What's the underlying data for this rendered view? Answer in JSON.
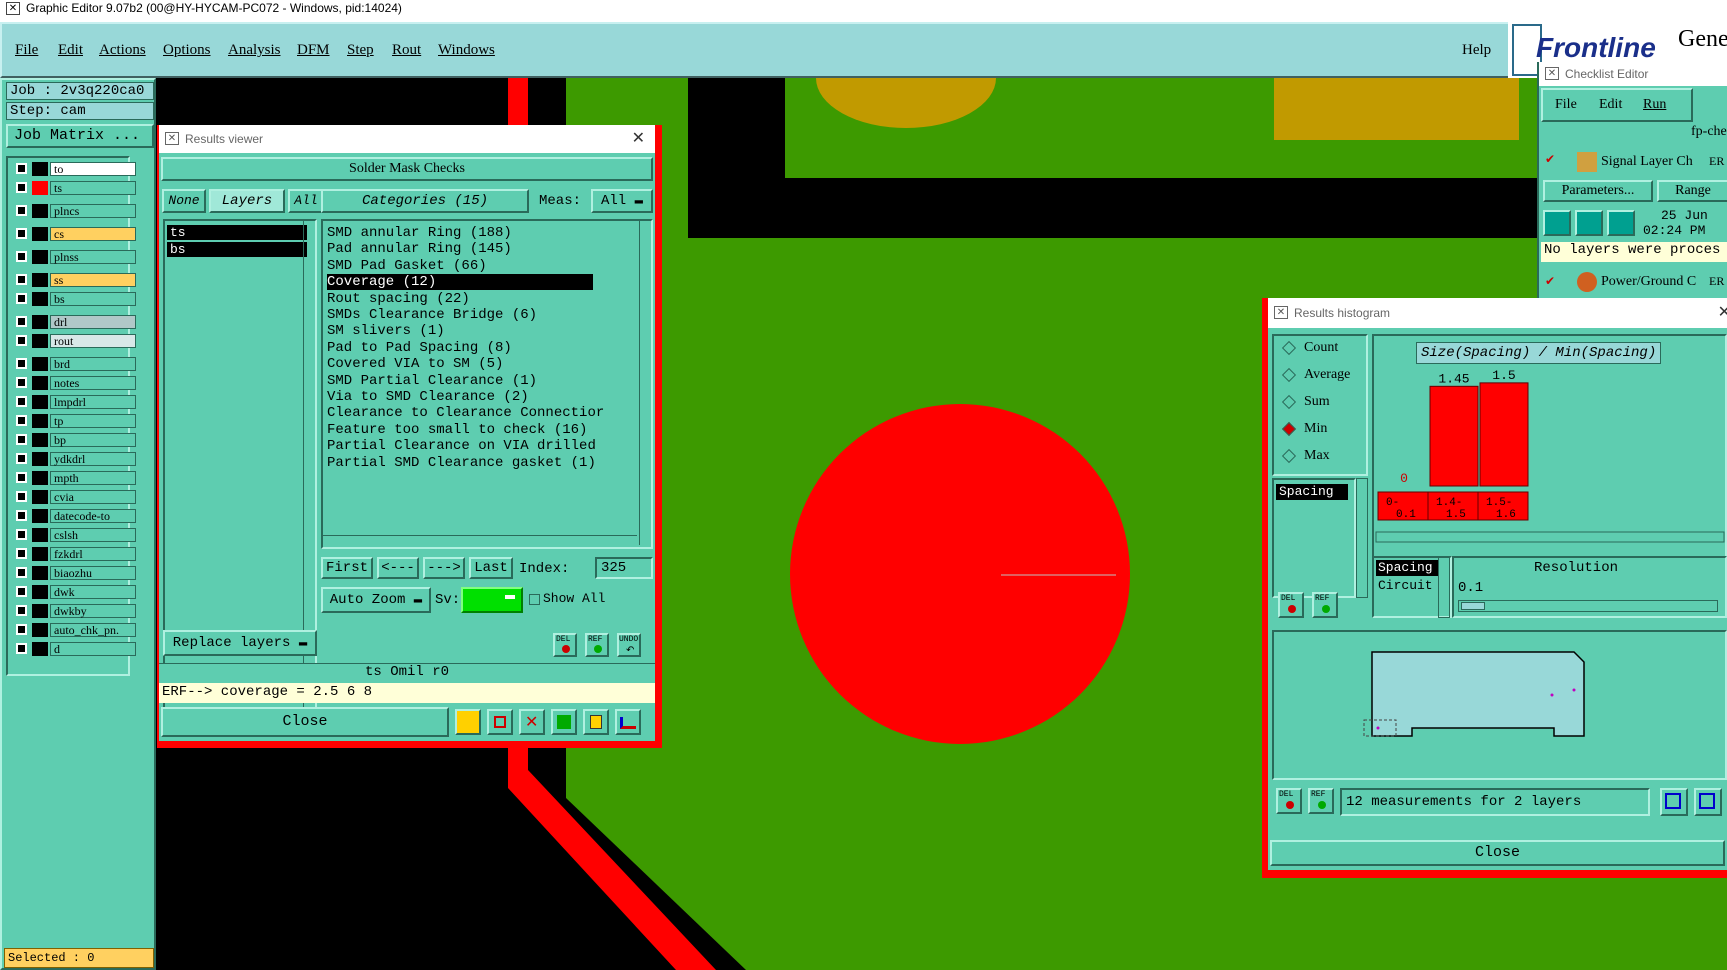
{
  "window": {
    "title": "Graphic Editor 9.07b2 (00@HY-HYCAM-PC072 - Windows, pid:14024)"
  },
  "menu": {
    "items": [
      "File",
      "Edit",
      "Actions",
      "Options",
      "Analysis",
      "DFM",
      "Step",
      "Rout",
      "Windows"
    ],
    "help": "Help",
    "brand": "Frontline",
    "brand2": "Gene"
  },
  "job": {
    "job": "Job : 2v3q220ca0",
    "step": "Step: cam",
    "matrix_btn": "Job Matrix ...",
    "selected": "Selected : 0"
  },
  "layers": [
    {
      "name": "to",
      "color": "#ffffff",
      "swatch": "#000000"
    },
    {
      "name": "ts",
      "color": "#5ecdb0",
      "swatch": "#ff0000",
      "active": true
    },
    {
      "name": "plncs",
      "color": "#5ecdb0",
      "swatch": "#000000"
    },
    {
      "name": "cs",
      "color": "#ffd060",
      "swatch": "#000000"
    },
    {
      "name": "plnss",
      "color": "#5ecdb0",
      "swatch": "#000000"
    },
    {
      "name": "ss",
      "color": "#ffd060",
      "swatch": "#000000"
    },
    {
      "name": "bs",
      "color": "#5ecdb0",
      "swatch": "#000000"
    },
    {
      "name": "drl",
      "color": "#b0c8c8",
      "swatch": "#000000"
    },
    {
      "name": "rout",
      "color": "#d8e8e8",
      "swatch": "#000000"
    },
    {
      "name": "brd",
      "color": "#5ecdb0",
      "swatch": "#000000"
    },
    {
      "name": "notes",
      "color": "#5ecdb0",
      "swatch": "#000000"
    },
    {
      "name": "lmpdrl",
      "color": "#5ecdb0",
      "swatch": "#000000"
    },
    {
      "name": "tp",
      "color": "#5ecdb0",
      "swatch": "#000000"
    },
    {
      "name": "bp",
      "color": "#5ecdb0",
      "swatch": "#000000"
    },
    {
      "name": "ydkdrl",
      "color": "#5ecdb0",
      "swatch": "#000000"
    },
    {
      "name": "mpth",
      "color": "#5ecdb0",
      "swatch": "#000000"
    },
    {
      "name": "cvia",
      "color": "#5ecdb0",
      "swatch": "#000000"
    },
    {
      "name": "datecode-to",
      "color": "#5ecdb0",
      "swatch": "#000000"
    },
    {
      "name": "cslsh",
      "color": "#5ecdb0",
      "swatch": "#000000"
    },
    {
      "name": "fzkdrl",
      "color": "#5ecdb0",
      "swatch": "#000000"
    },
    {
      "name": "biaozhu",
      "color": "#5ecdb0",
      "swatch": "#000000"
    },
    {
      "name": "dwk",
      "color": "#5ecdb0",
      "swatch": "#000000"
    },
    {
      "name": "dwkby",
      "color": "#5ecdb0",
      "swatch": "#000000"
    },
    {
      "name": "auto_chk_pn.",
      "color": "#5ecdb0",
      "swatch": "#000000"
    },
    {
      "name": "d",
      "color": "#5ecdb0",
      "swatch": "#000000"
    }
  ],
  "results_viewer": {
    "title": "Results viewer",
    "header": "Solder Mask Checks",
    "none": "None",
    "layers_label": "Layers",
    "all": "All",
    "categories_label": "Categories (15)",
    "meas_label": "Meas:",
    "meas_value": "All",
    "layer_list": [
      "ts",
      "bs"
    ],
    "categories": [
      "SMD annular Ring (188)",
      "Pad annular Ring (145)",
      "SMD Pad Gasket (66)",
      "Coverage (12)",
      "Rout spacing (22)",
      "SMDs Clearance Bridge (6)",
      "SM slivers (1)",
      "Pad to Pad Spacing (8)",
      "Covered VIA to SM (5)",
      "SMD Partial Clearance (1)",
      "Via to SMD Clearance (2)",
      "Clearance to Clearance Connectior",
      "Feature too small to check (16)",
      "Partial Clearance on VIA drilled",
      "Partial SMD Clearance gasket (1)"
    ],
    "selected_category": 3,
    "nav": {
      "first": "First",
      "prev": "<---",
      "next": "--->",
      "last": "Last",
      "index_label": "Index:",
      "index_value": "325"
    },
    "auto_zoom": "Auto Zoom",
    "sv_label": "Sv:",
    "show_all": "Show All",
    "replace_layers": "Replace layers",
    "small_btns": [
      "DEL",
      "REF",
      "UNDO"
    ],
    "status1": "ts Omil  r0",
    "status2": "ERF--> coverage = 2.5 6 8",
    "close": "Close"
  },
  "checklist": {
    "title": "Checklist Editor",
    "menu": [
      "File",
      "Edit",
      "Run"
    ],
    "name": "fp-che",
    "item1": "Signal Layer Ch",
    "item1_tag": "ER",
    "params": "Parameters...",
    "range": "Range",
    "date": "25 Jun",
    "time": "02:24 PM",
    "msg": "No layers were proces",
    "item2": "Power/Ground C",
    "item2_tag": "ER"
  },
  "histogram": {
    "title": "Results histogram",
    "modes": [
      "Count",
      "Average",
      "Sum",
      "Min",
      "Max"
    ],
    "selected_mode": "Min",
    "measure_list": [
      "Spacing"
    ],
    "chart_title": "Size(Spacing) / Min(Spacing)",
    "chart_data": {
      "type": "bar",
      "categories": [
        "0-0.1",
        "1.4-1.5",
        "1.5-1.6"
      ],
      "values": [
        0,
        1.45,
        1.5
      ],
      "value_labels": [
        "0",
        "1.45",
        "1.5"
      ],
      "title": "Size(Spacing) / Min(Spacing)",
      "ylim": [
        0,
        1.6
      ]
    },
    "types": [
      "Spacing",
      "Circuit"
    ],
    "resolution_label": "Resolution",
    "resolution_value": "0.1",
    "measurements": "12 measurements for 2 layers",
    "close": "Close",
    "del": "DEL",
    "ref": "REF"
  },
  "colors": {
    "board": "#3d9a00",
    "red": "#ff0000",
    "panel": "#5ecdb0",
    "gold": "#c19a00"
  }
}
